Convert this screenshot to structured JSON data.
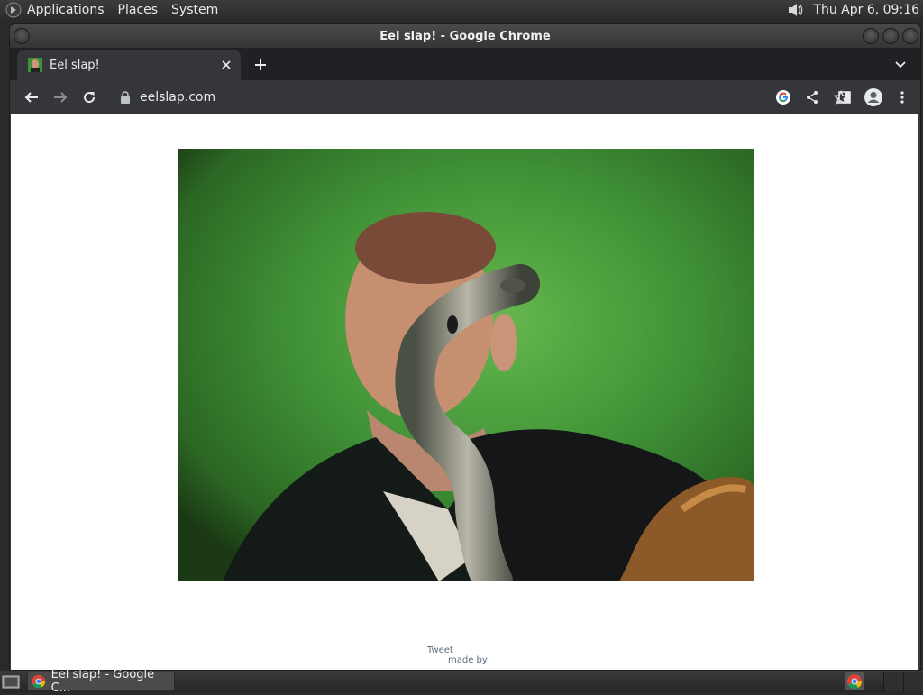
{
  "top_panel": {
    "menus": [
      "Applications",
      "Places",
      "System"
    ],
    "clock": "Thu Apr  6, 09:16"
  },
  "window": {
    "title": "Eel slap! - Google Chrome"
  },
  "tabs": [
    {
      "label": "Eel slap!"
    }
  ],
  "toolbar": {
    "url": "eelslap.com"
  },
  "page": {
    "photo_alt": "Eel slap photo",
    "tweet_label": "Tweet",
    "made_by_label": "made by"
  },
  "taskbar": {
    "task_label": "Eel slap! - Google C..."
  },
  "colors": {
    "chrome_dark": "#202124",
    "chrome_toolbar": "#35363a",
    "page_bg": "#ffffff",
    "green_screen": "#3f9136"
  }
}
